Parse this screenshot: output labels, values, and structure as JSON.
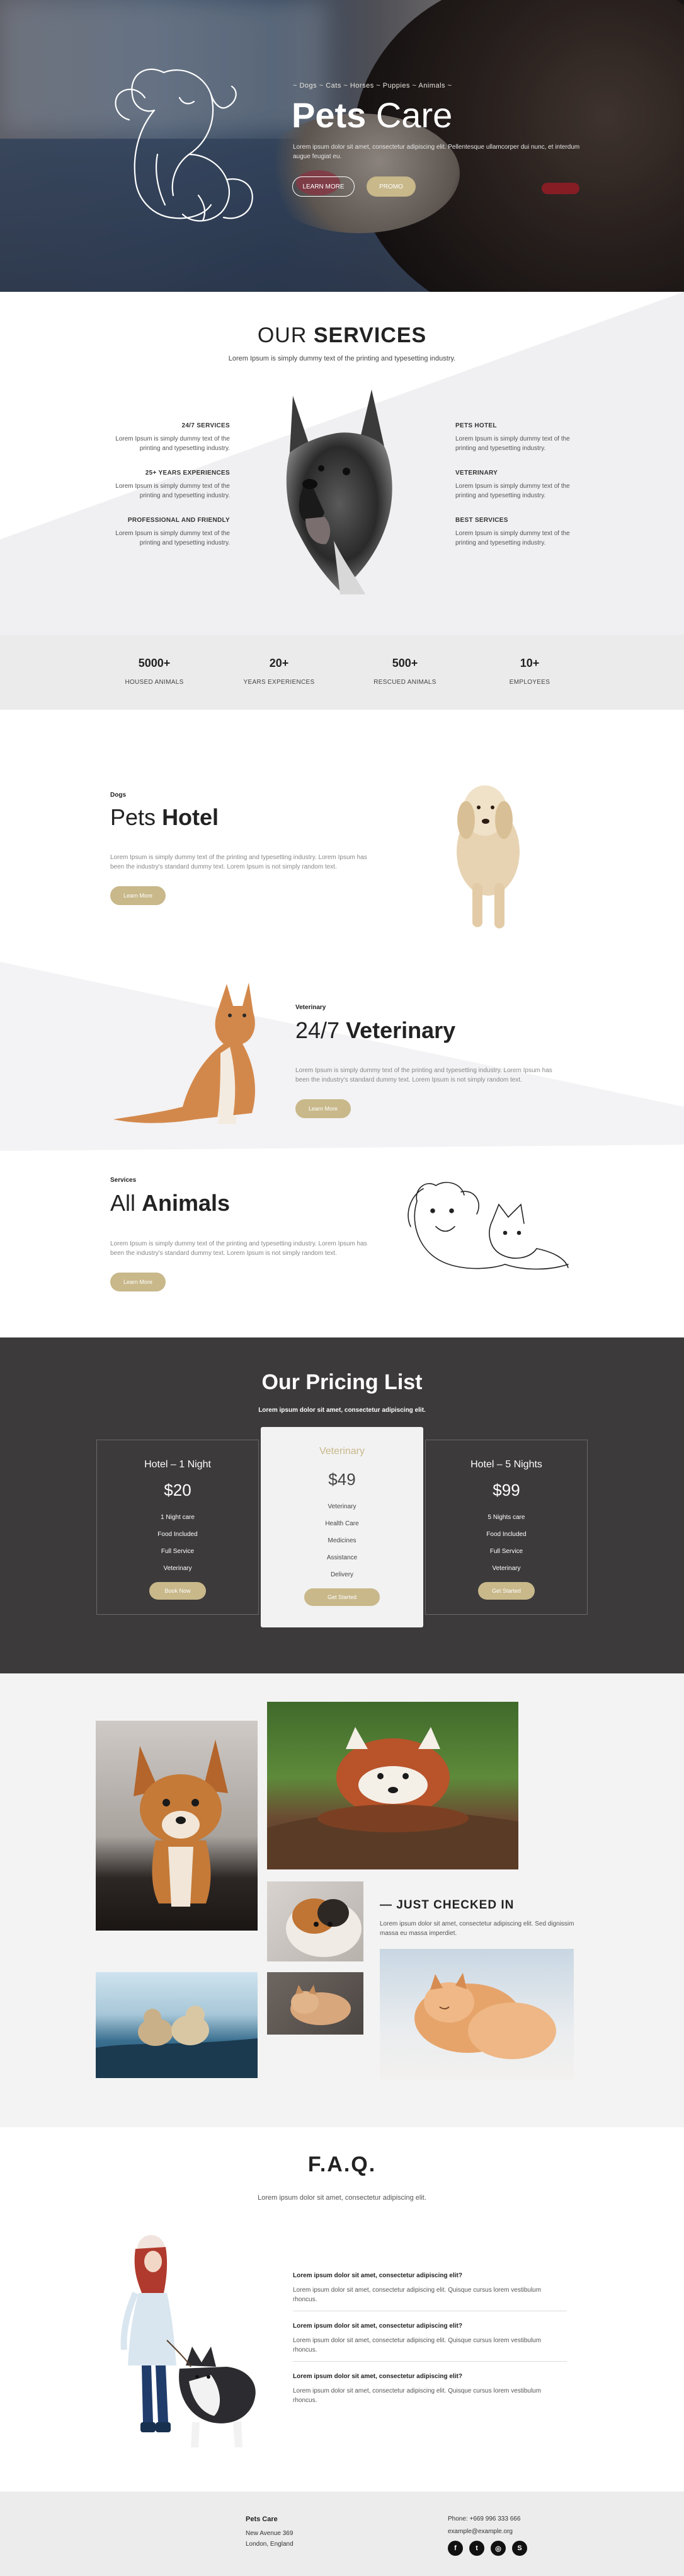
{
  "hero": {
    "nav_sub": "~ Dogs ~ Cats ~ Horses ~ Puppies ~ Animals ~",
    "title_bold": "Pets",
    "title_light": "Care",
    "desc": "Lorem ipsum dolor sit amet, consectetur adipiscing elit. Pellentesque ullamcorper dui nunc, et interdum augue feugiat eu.",
    "btn_learn": "LEARN MORE",
    "btn_promo": "PROMO"
  },
  "services": {
    "title_light": "OUR",
    "title_bold": "SERVICES",
    "intro": "Lorem Ipsum is simply dummy text of the printing and typesetting industry.",
    "left": [
      {
        "title": "24/7 SERVICES",
        "text": "Lorem Ipsum is simply dummy text of the printing and typesetting industry."
      },
      {
        "title": "25+ YEARS EXPERIENCES",
        "text": "Lorem Ipsum is simply dummy text of the printing and typesetting industry."
      },
      {
        "title": "PROFESSIONAL AND FRIENDLY",
        "text": "Lorem Ipsum is simply dummy text of the printing and typesetting industry."
      }
    ],
    "right": [
      {
        "title": "PETS HOTEL",
        "text": "Lorem Ipsum is simply dummy text of the printing and typesetting industry."
      },
      {
        "title": "VETERINARY",
        "text": "Lorem Ipsum is simply dummy text of the printing and typesetting industry."
      },
      {
        "title": "BEST SERVICES",
        "text": "Lorem Ipsum is simply dummy text of the printing and typesetting industry."
      }
    ]
  },
  "stats": [
    {
      "num": "5000+",
      "label": "HOUSED ANIMALS"
    },
    {
      "num": "20+",
      "label": "YEARS EXPERIENCES"
    },
    {
      "num": "500+",
      "label": "RESCUED ANIMALS"
    },
    {
      "num": "10+",
      "label": "EMPLOYEES"
    }
  ],
  "features": [
    {
      "kicker": "Dogs",
      "title_light": "Pets",
      "title_bold": "Hotel",
      "desc": "Lorem Ipsum is simply dummy text of the printing and typesetting industry. Lorem Ipsum has been the industry's standard dummy text. Lorem Ipsum is not simply random text.",
      "btn": "Learn More"
    },
    {
      "kicker": "Veterinary",
      "title_light": "24/7",
      "title_bold": "Veterinary",
      "desc": "Lorem Ipsum is simply dummy text of the printing and typesetting industry. Lorem Ipsum has been the industry's standard dummy text. Lorem Ipsum is not simply random text.",
      "btn": "Learn More"
    },
    {
      "kicker": "Services",
      "title_light": "All",
      "title_bold": "Animals",
      "desc": "Lorem Ipsum is simply dummy text of the printing and typesetting industry. Lorem Ipsum has been the industry's standard dummy text. Lorem Ipsum is not simply random text.",
      "btn": "Learn More"
    }
  ],
  "pricing": {
    "title": "Our Pricing List",
    "intro": "Lorem ipsum dolor sit amet, consectetur adipiscing elit.",
    "plans": [
      {
        "name": "Hotel – 1 Night",
        "price": "$20",
        "items": [
          "1 Night care",
          "Food Included",
          "Full Service",
          "Veterinary"
        ],
        "btn": "Book Now"
      },
      {
        "name": "Veterinary",
        "price": "$49",
        "items": [
          "Veterinary",
          "Health Care",
          "Medicines",
          "Assistance",
          "Delivery"
        ],
        "btn": "Get Started"
      },
      {
        "name": "Hotel – 5 Nights",
        "price": "$99",
        "items": [
          "5 Nights care",
          "Food Included",
          "Full Service",
          "Veterinary"
        ],
        "btn": "Get Started"
      }
    ]
  },
  "gallery": {
    "title": "— JUST CHECKED IN",
    "desc": "Lorem ipsum dolor sit amet, consectetur adipiscing elit. Sed dignissim massa eu massa imperdiet."
  },
  "faq": {
    "title": "F.A.Q.",
    "intro": "Lorem ipsum dolor sit amet, consectetur adipiscing elit.",
    "items": [
      {
        "q": "Lorem ipsum dolor sit amet, consectetur adipiscing elit?",
        "a": "Lorem ipsum dolor sit amet, consectetur adipiscing elit. Quisque cursus lorem vestibulum rhoncus."
      },
      {
        "q": "Lorem ipsum dolor sit amet, consectetur adipiscing elit?",
        "a": "Lorem ipsum dolor sit amet, consectetur adipiscing elit. Quisque cursus lorem vestibulum rhoncus."
      },
      {
        "q": "Lorem ipsum dolor sit amet, consectetur adipiscing elit?",
        "a": "Lorem ipsum dolor sit amet, consectetur adipiscing elit. Quisque cursus lorem vestibulum rhoncus."
      }
    ]
  },
  "footer": {
    "brand": "Pets Care",
    "address1": "New Avenue 369",
    "address2": "London, England",
    "phone": "Phone: +669 996 333 666",
    "email": "example@example.org",
    "socials": [
      {
        "icon": "facebook-icon",
        "glyph": "f"
      },
      {
        "icon": "twitter-icon",
        "glyph": "t"
      },
      {
        "icon": "instagram-icon",
        "glyph": "◎"
      },
      {
        "icon": "skype-icon",
        "glyph": "S"
      }
    ]
  },
  "colors": {
    "accent": "#c8b88a",
    "dark": "#3c3a3b",
    "light": "#f3f3f3"
  }
}
